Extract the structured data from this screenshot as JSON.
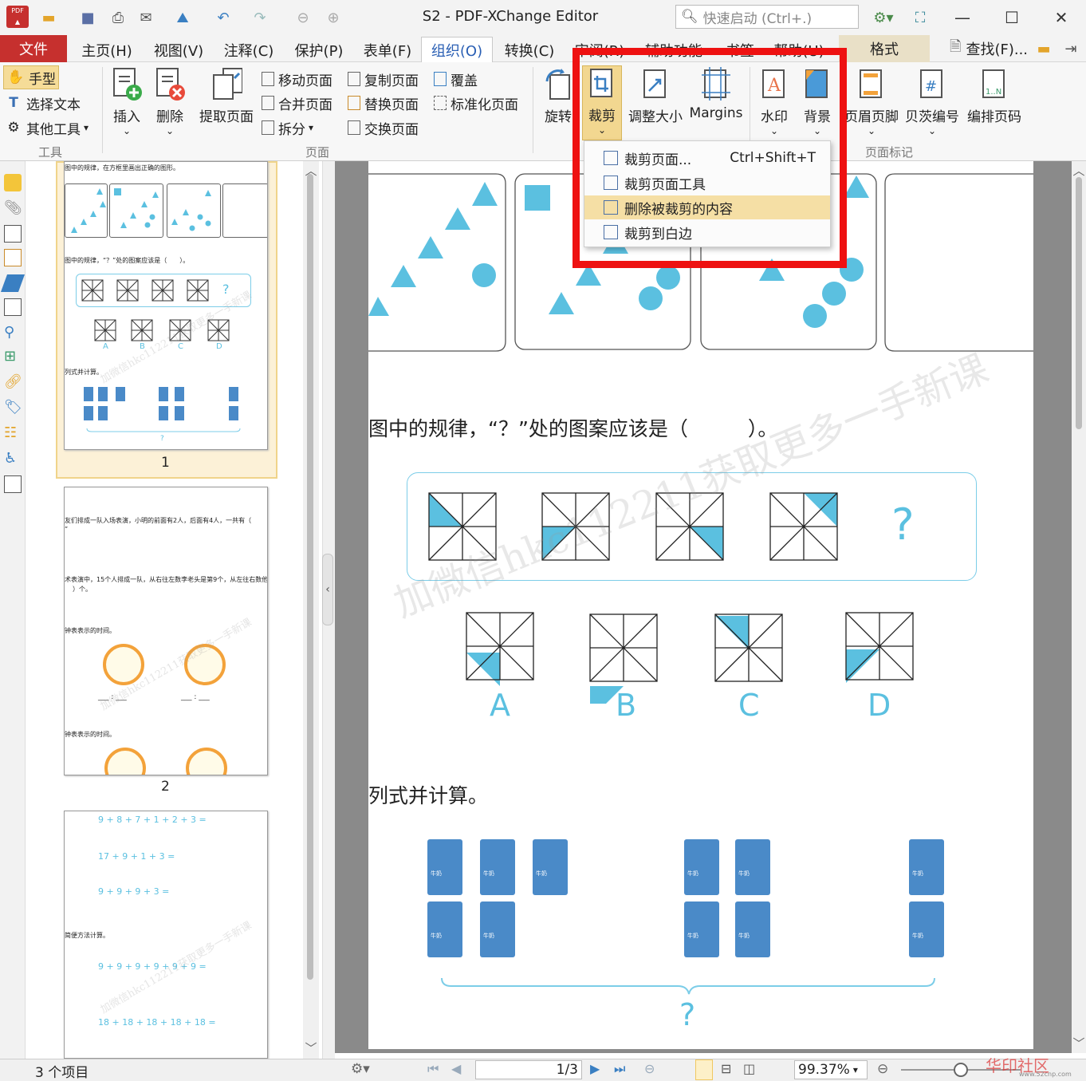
{
  "window": {
    "title": "S2 - PDF-XChange Editor",
    "search_placeholder": "快速启动 (Ctrl+.)"
  },
  "menu": {
    "file": "文件",
    "tabs": [
      "主页(H)",
      "视图(V)",
      "注释(C)",
      "保护(P)",
      "表单(F)",
      "组织(O)",
      "转换(C)",
      "审阅(R)",
      "辅助功能",
      "书签",
      "帮助(U)"
    ],
    "active": "组织(O)",
    "format": "格式",
    "find": "查找(F)..."
  },
  "ribbon": {
    "tools": {
      "hand": "手型",
      "select_text": "选择文本",
      "other_tools": "其他工具",
      "group": "工具"
    },
    "pages": {
      "insert": "插入",
      "delete": "删除",
      "extract": "提取页面",
      "move": "移动页面",
      "merge": "合并页面",
      "split": "拆分",
      "copy": "复制页面",
      "replace": "替换页面",
      "swap": "交换页面",
      "overlay": "覆盖",
      "normalize": "标准化页面",
      "group": "页面"
    },
    "rotate": "旋转",
    "crop": "裁剪",
    "resize": "调整大小",
    "margins": "Margins",
    "watermark": "水印",
    "background": "背景",
    "header_footer": "页眉页脚",
    "bates": "贝茨编号",
    "page_number": "编排页码",
    "page_marks_group": "页面标记"
  },
  "crop_menu": {
    "items": [
      {
        "label": "裁剪页面...",
        "shortcut": "Ctrl+Shift+T"
      },
      {
        "label": "裁剪页面工具",
        "shortcut": ""
      },
      {
        "label": "删除被裁剪的内容",
        "shortcut": ""
      },
      {
        "label": "裁剪到白边",
        "shortcut": ""
      }
    ],
    "highlighted_index": 2
  },
  "thumbnails": {
    "page_numbers": [
      "1",
      "2",
      "3"
    ],
    "t1": {
      "q1": "图中的规律，在方框里画出正确的图形。",
      "q2": "图中的规律，“？”处的图案应该是（　　）。",
      "q3": "列式并计算。",
      "opts": [
        "A",
        "B",
        "C",
        "D"
      ],
      "qmark": "?"
    },
    "t2": {
      "q1": "友们排成一队入场表演，小明的前面有2人，后面有4人，一共有（",
      "q1b": "”",
      "q2": "术表演中，15个人排成一队，从右往左数李老头是第9个，从左往右数他",
      "q2b": "）个。",
      "q3": "钟表表示的时间。",
      "q4": "钟表表示的时间。",
      "blank": "___ : ___"
    },
    "t3": {
      "eq1": "9 + 8 + 7 + 1 + 2 + 3 =",
      "eq2": "17 + 9 + 1 + 3 =",
      "eq3": "9 + 9 + 9 + 3 =",
      "note": "简便方法计算。",
      "eq4": "9 + 9 + 9 + 9 + 9 + 9 =",
      "eq5": "18 + 18 + 18 + 18 + 18 ="
    },
    "watermark": "加微信hkc112211获取更多一手新课"
  },
  "document": {
    "question": "图中的规律，“？”处的图案应该是（　　　）。",
    "options": [
      "A",
      "B",
      "C",
      "D"
    ],
    "qmark": "?",
    "section": "列式并计算。",
    "milk_label": "牛奶",
    "watermark": "加微信hkc112211获取更多一手新课"
  },
  "status": {
    "items": "3 个项目",
    "page": "1",
    "total": "/3",
    "zoom": "99.37%",
    "site": "www.52cnp.com",
    "brand": "华印社区"
  }
}
